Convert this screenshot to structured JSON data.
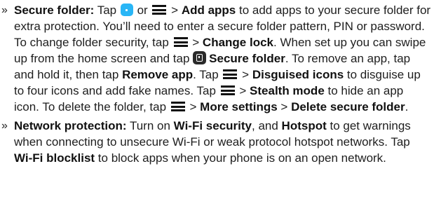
{
  "bullet_glyph": "»",
  "icons": {
    "menu": "menu-icon",
    "app": "secure-folder-app-icon",
    "folder": "secure-folder-icon",
    "app_color": "#29b6f6"
  },
  "secure_folder": {
    "t1": "Secure folder:",
    "t2": " Tap ",
    "t3": " or ",
    "t4": " > ",
    "t5": "Add apps",
    "t6": " to add apps to your secure folder for extra protection. You’ll need to enter a secure folder pattern, PIN or password. To change folder security, tap ",
    "t7": " > ",
    "t8": "Change lock",
    "t9": ". When set up you can swipe up from the home screen and tap ",
    "t10": "Secure folder",
    "t11": ". To remove an app, tap and hold it, then tap ",
    "t12": "Remove app",
    "t13": ". Tap ",
    "t14": " > ",
    "t15": "Disguised icons",
    "t16": " to disguise up to four icons and add fake names. Tap ",
    "t17": " > ",
    "t18": "Stealth mode",
    "t19": " to hide an app icon. To delete the folder, tap ",
    "t20": " > ",
    "t21": "More settings",
    "t22": " > ",
    "t23": "Delete secure folder",
    "t24": "."
  },
  "network_protection": {
    "t1": "Network protection:",
    "t2": " Turn on ",
    "t3": "Wi-Fi security",
    "t4": ", and ",
    "t5": "Hotspot",
    "t6": " to get warnings when connecting to unsecure Wi-Fi or weak protocol hotspot networks. Tap ",
    "t7": "Wi-Fi blocklist",
    "t8": " to block apps when your phone is on an open network."
  }
}
